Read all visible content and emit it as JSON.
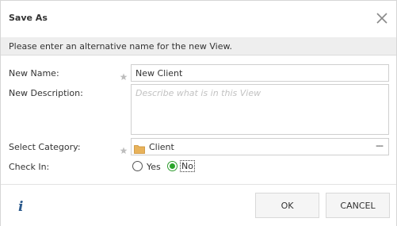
{
  "dialog": {
    "title": "Save As",
    "close_icon": "close-icon",
    "info_message": "Please enter an alternative name for the new View."
  },
  "form": {
    "name": {
      "label": "New Name:",
      "value": "New Client",
      "required_icon": "asterisk-icon"
    },
    "description": {
      "label": "New Description:",
      "value": "",
      "placeholder": "Describe what is in this View"
    },
    "category": {
      "label": "Select Category:",
      "value": "Client",
      "icon": "folder-icon",
      "more_label": "---",
      "required_icon": "asterisk-icon"
    },
    "check_in": {
      "label": "Check In:",
      "options": [
        {
          "label": "Yes",
          "checked": false
        },
        {
          "label": "No",
          "checked": true
        }
      ]
    }
  },
  "footer": {
    "info_icon_label": "i",
    "ok_label": "OK",
    "cancel_label": "CANCEL"
  },
  "colors": {
    "info_bar": "#eeeeee",
    "radio_checked": "#2aa52a",
    "folder": "#e8b25a",
    "info_icon": "#2c5a8c"
  }
}
